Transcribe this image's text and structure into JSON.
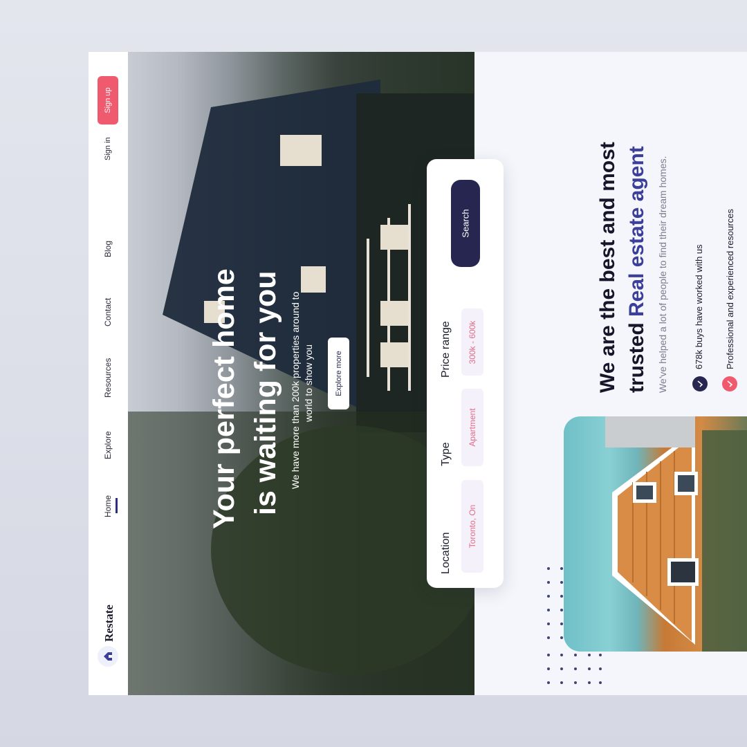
{
  "nav": {
    "brand": "Restate",
    "items": [
      "Home",
      "Explore",
      "Resources",
      "Contact",
      "Blog"
    ],
    "sign_in": "Sign in",
    "sign_up": "Sign up"
  },
  "hero": {
    "title_line1": "Your perfect home",
    "title_line2": "is waiting for you",
    "subtitle_line1": "We have more than 200k properties around to",
    "subtitle_line2": "world to show you",
    "cta": "Explore more"
  },
  "search": {
    "location_label": "Location",
    "location_value": "Toronto, On",
    "type_label": "Type",
    "type_value": "Apartment",
    "price_label": "Price range",
    "price_value": "300k - 600k",
    "button": "Search"
  },
  "about": {
    "heading_line1": "We are the best and most",
    "heading_line2_plain": "trusted ",
    "heading_line2_accent": "Real estate agent",
    "subtext": "We've helped a lot of people to find their dream homes.",
    "feature1": "678k buys have worked with us",
    "feature2": "Professional and experienced resources"
  },
  "colors": {
    "accent": "#f05a6f",
    "navy": "#262650",
    "brand_blue": "#3c3f99"
  },
  "icons": [
    "house-logo-icon",
    "check-icon"
  ]
}
